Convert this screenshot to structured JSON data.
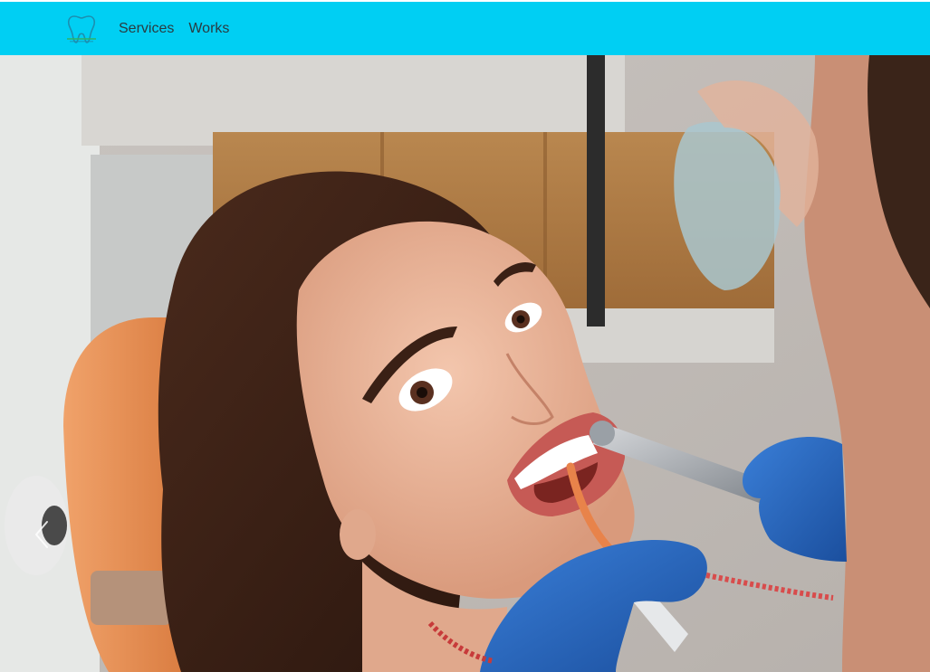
{
  "nav": {
    "links": [
      {
        "label": "Services"
      },
      {
        "label": "Works"
      }
    ]
  },
  "colors": {
    "navbar_bg": "#00cff3",
    "nav_text": "#2a3b40"
  },
  "logo": {
    "icon": "tooth-icon"
  },
  "carousel": {
    "slide_image": "dental-patient-photo",
    "prev_icon": "chevron-left-icon",
    "next_icon": "chevron-right-icon"
  }
}
